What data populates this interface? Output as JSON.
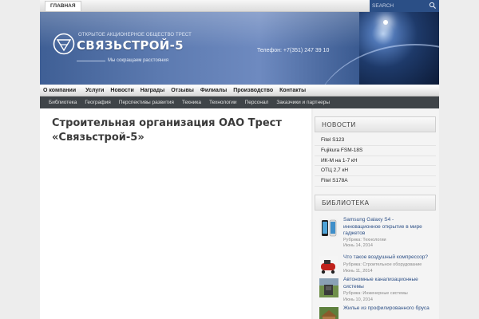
{
  "topbar": {
    "home_label": "ГЛАВНАЯ",
    "search_placeholder": "SEARCH"
  },
  "header": {
    "logo_top": "ОТКРЫТОЕ АКЦИОНЕРНОЕ ОБЩЕСТВО ТРЕСТ",
    "logo_name": "СВЯЗЬСТРОЙ-5",
    "slogan": "Мы сокращаем расстояния",
    "phone": "Телефон: +7(351) 247 39 10"
  },
  "main_menu": [
    {
      "label": "О компании"
    },
    {
      "label": "Услуги"
    },
    {
      "label": "Новости"
    },
    {
      "label": "Награды"
    },
    {
      "label": "Отзывы"
    },
    {
      "label": "Филиалы"
    },
    {
      "label": "Производство"
    },
    {
      "label": "Контакты"
    }
  ],
  "sub_menu": [
    {
      "label": "Библиотека"
    },
    {
      "label": "География"
    },
    {
      "label": "Перспективы развития"
    },
    {
      "label": "Техника"
    },
    {
      "label": "Технологии"
    },
    {
      "label": "Персонал"
    },
    {
      "label": "Заказчики и партнеры"
    }
  ],
  "content": {
    "title": "Строительная организация ОАО Трест «Связьстрой-5»"
  },
  "sidebar": {
    "news_heading": "НОВОСТИ",
    "news": [
      {
        "label": "Fitel S123"
      },
      {
        "label": "Fujikura FSM-18S"
      },
      {
        "label": "ИК-М на 1-7 кН"
      },
      {
        "label": "ОТЦ 2,7 кН"
      },
      {
        "label": "Fitel S178A"
      }
    ],
    "library_heading": "БИБЛИОТЕКА",
    "library": [
      {
        "title": "Samsung Galaxy S4 - инновационное открытие в мире гаджетов",
        "meta": "Рубрика: Технологии",
        "date": "Июнь 14, 2014"
      },
      {
        "title": "Что такое воздушный компрессор?",
        "meta": "Рубрика: Строительное оборудование",
        "date": "Июнь 11, 2014"
      },
      {
        "title": "Автономные канализационные системы",
        "meta": "Рубрика: Инженерные системы",
        "date": "Июнь 10, 2014"
      },
      {
        "title": "Жилье из профилированного бруса",
        "meta": "",
        "date": ""
      }
    ]
  }
}
